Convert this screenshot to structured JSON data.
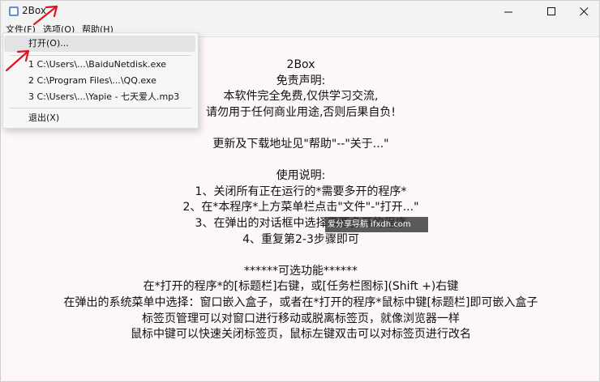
{
  "window": {
    "title": "2Box"
  },
  "menubar": {
    "items": [
      "文件(F)",
      "选项(O)",
      "帮助(H)"
    ]
  },
  "file_menu": {
    "open": "打开(O)...",
    "recent": [
      "1 C:\\Users\\...\\BaiduNetdisk.exe",
      "2 C:\\Program Files\\...\\QQ.exe",
      "3 C:\\Users\\...\\Yapie - 七天爱人.mp3"
    ],
    "exit": "退出(X)"
  },
  "content": {
    "lines": [
      "2Box",
      "免责声明:",
      "本软件完全免费,仅供学习交流,",
      "请勿用于任何商业用途,否则后果自负!",
      "",
      "更新及下载地址见\"帮助\"--\"关于...\"",
      "",
      "使用说明:",
      "1、关闭所有正在运行的*需要多开的程序*",
      "2、在*本程序*上方菜单栏点击\"文件\"-\"打开...\"",
      "3、在弹出的对话框中选择需要多开的程序",
      "4、重复第2-3步骤即可",
      "",
      "******可选功能******",
      "在*打开的程序*的[标题栏]右键，或[任务栏图标](Shift +)右键",
      "在弹出的系统菜单中选择：窗口嵌入盒子，或者在*打开的程序*鼠标中键[标题栏]即可嵌入盒子",
      "标签页管理可以对窗口进行移动或脱离标签页，就像浏览器一样",
      "鼠标中键可以快速关闭标签页，鼠标左键双击可以对标签页进行改名"
    ]
  },
  "watermark": {
    "text": "爱分享导航 ifxdh.com"
  },
  "colors": {
    "annotation_arrow": "#e0141e",
    "window_bg": "#fdf7f7",
    "chrome": "#f3f3f3"
  },
  "icons": [
    "app-icon",
    "minimize-icon",
    "maximize-icon",
    "close-icon",
    "annotation-arrow-icon"
  ]
}
